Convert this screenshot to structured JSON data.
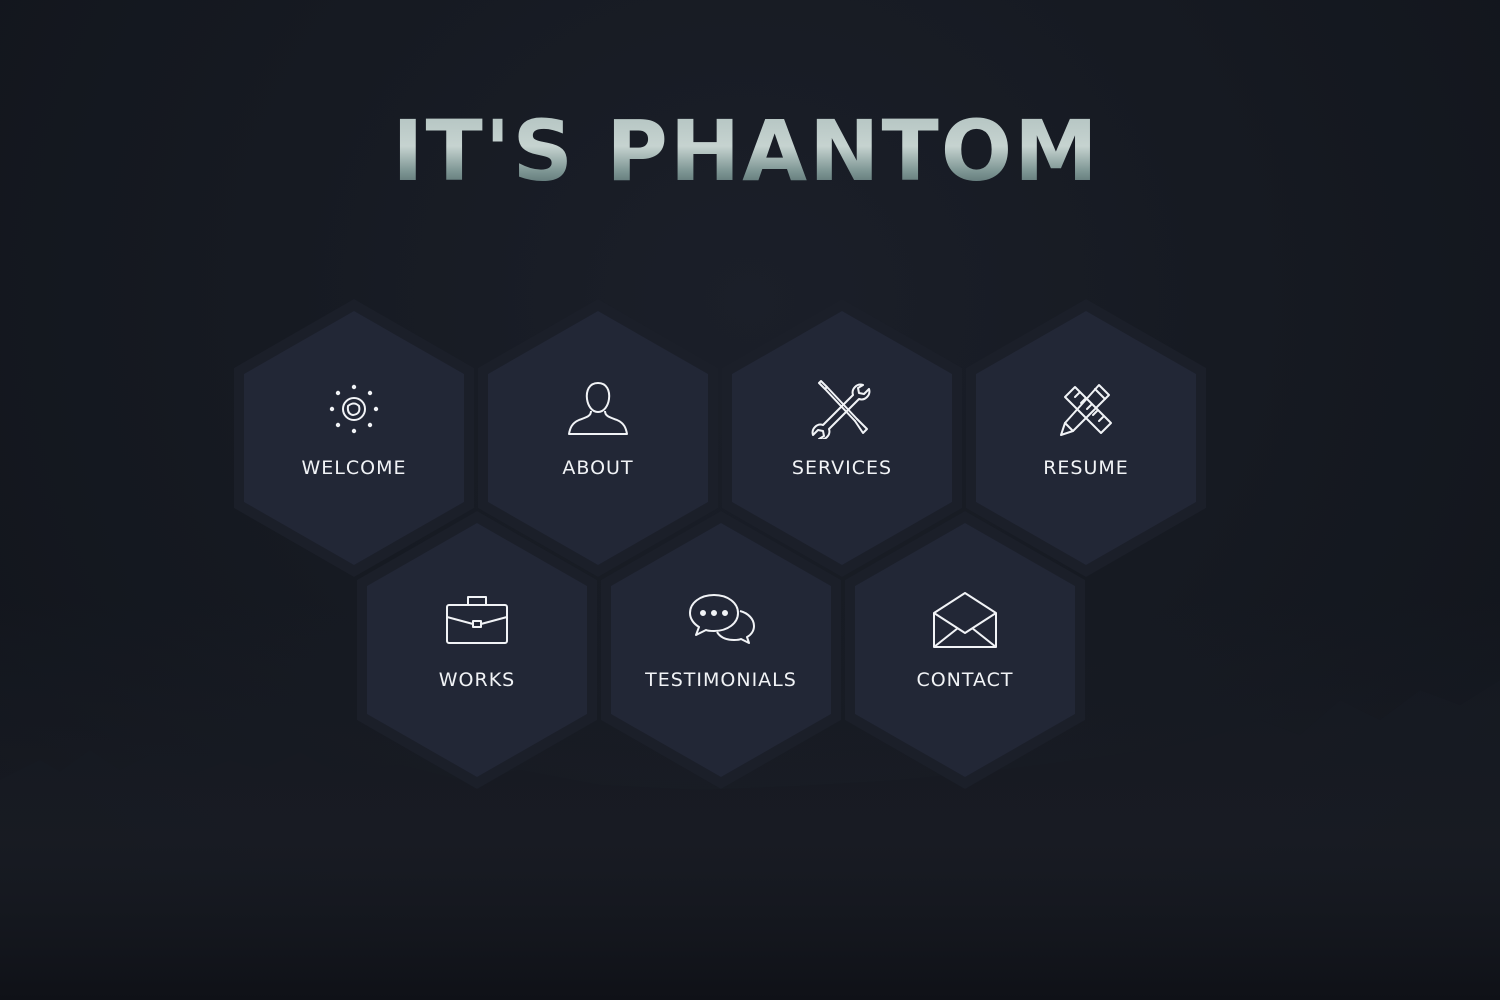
{
  "header": {
    "title": "IT'S PHANTOM"
  },
  "nav": {
    "items": [
      {
        "id": "welcome",
        "label": "WELCOME",
        "icon": "compass-icon"
      },
      {
        "id": "about",
        "label": "ABOUT",
        "icon": "user-icon"
      },
      {
        "id": "services",
        "label": "SERVICES",
        "icon": "tools-icon"
      },
      {
        "id": "resume",
        "label": "RESUME",
        "icon": "pencil-ruler-icon"
      },
      {
        "id": "works",
        "label": "WORKS",
        "icon": "briefcase-icon"
      },
      {
        "id": "testimonials",
        "label": "TESTIMONIALS",
        "icon": "chat-bubbles-icon"
      },
      {
        "id": "contact",
        "label": "CONTACT",
        "icon": "envelope-icon"
      }
    ]
  },
  "colors": {
    "background": "#141720",
    "hex_fill": "#212634",
    "hex_border": "#1a1e28",
    "text": "#f1f3f6",
    "title_light": "#b7c8c6",
    "title_dark": "#4f6b6e"
  }
}
